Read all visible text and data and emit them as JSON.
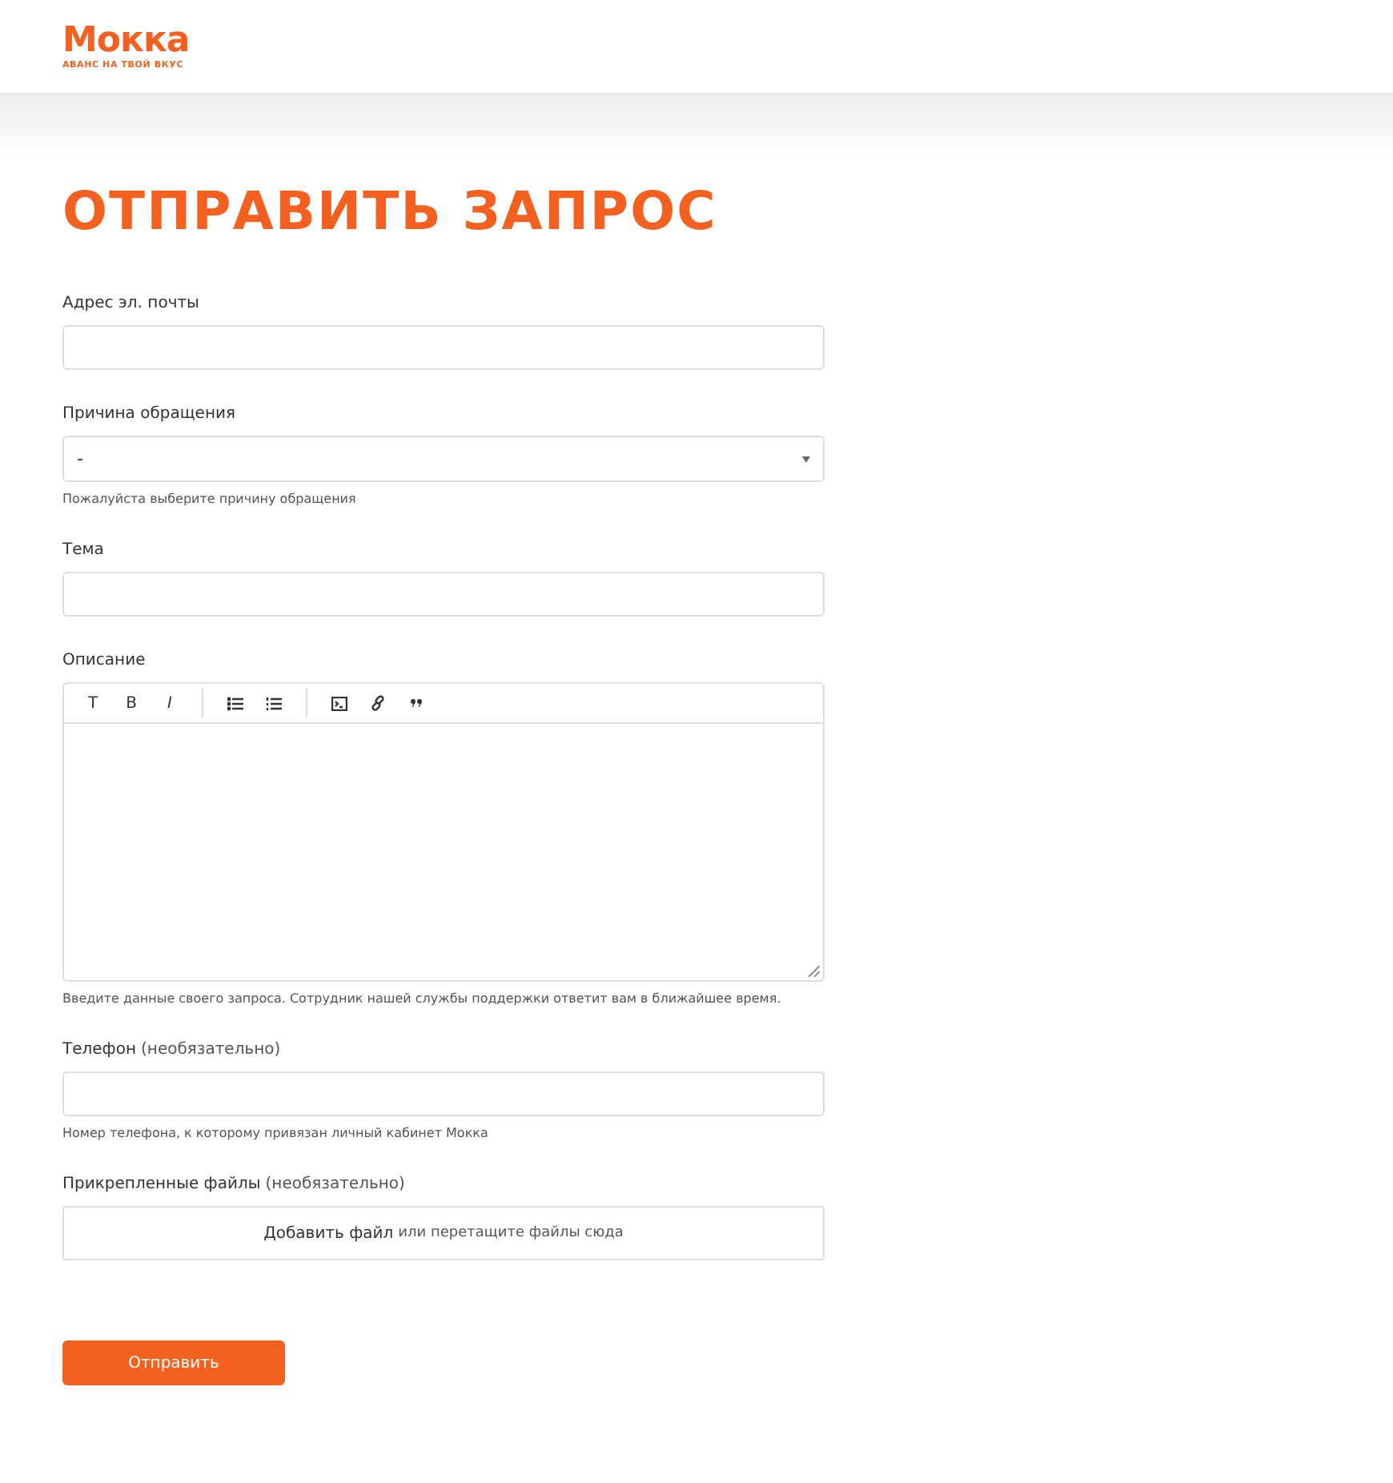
{
  "logo": {
    "name": "Мокка",
    "tagline": "АВАНС НА ТВОЙ ВКУС"
  },
  "title": "ОТПРАВИТЬ ЗАПРОС",
  "fields": [
    {
      "kind": "text",
      "label": "Адрес эл. почты"
    },
    {
      "kind": "select",
      "label": "Причина обращения",
      "value": "-",
      "hint": "Пожалуйста выберите причину обращения"
    },
    {
      "kind": "text",
      "label": "Тема"
    },
    {
      "kind": "editor",
      "label": "Описание",
      "toolbar": [
        {
          "kind": "text",
          "label": "T"
        },
        {
          "kind": "bold",
          "label": "B"
        },
        {
          "kind": "italic",
          "label": "I"
        },
        {
          "kind": "sep"
        },
        {
          "kind": "bullets"
        },
        {
          "kind": "numbers"
        },
        {
          "kind": "sep"
        },
        {
          "kind": "code"
        },
        {
          "kind": "link"
        },
        {
          "kind": "quote"
        }
      ],
      "hint": "Введите данные своего запроса. Сотрудник нашей службы поддержки ответит вам в ближайшее время."
    },
    {
      "kind": "text",
      "label": "Телефон",
      "optional": "(необязательно)",
      "hint": "Номер телефона, к которому привязан личный кабинет Мокка"
    },
    {
      "kind": "file",
      "label": "Прикрепленные файлы",
      "optional": "(необязательно)",
      "link": "Добавить файл",
      "rest": "или перетащите файлы сюда"
    }
  ],
  "submit": "Отправить"
}
